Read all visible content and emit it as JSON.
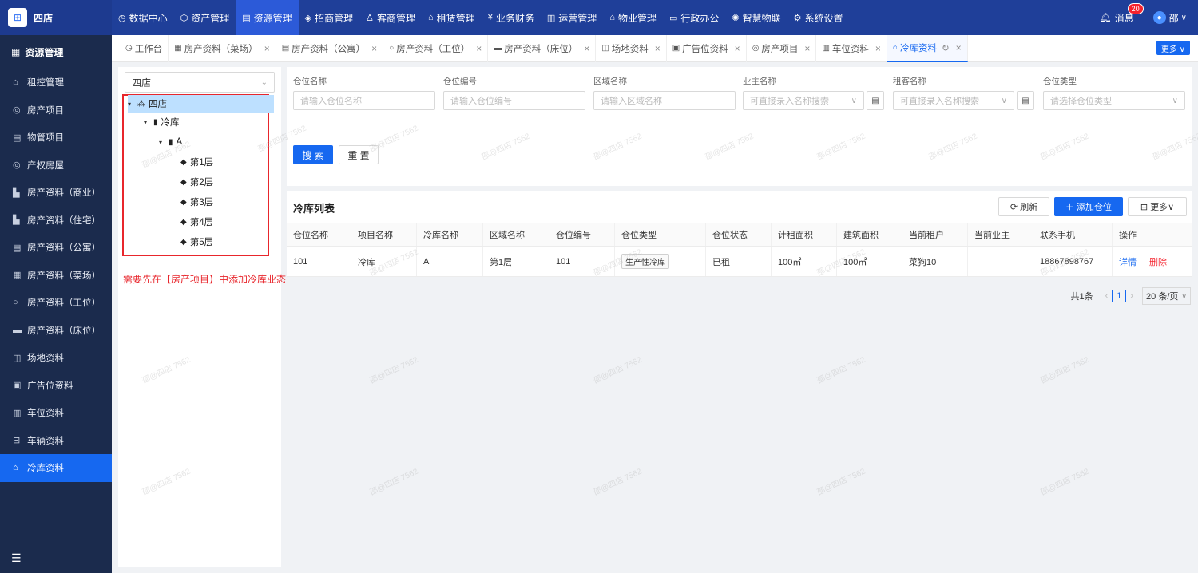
{
  "brand": {
    "logo": "⊞",
    "name": "四店"
  },
  "topnav": [
    {
      "icon": "◷",
      "label": "数据中心"
    },
    {
      "icon": "⬡",
      "label": "资产管理"
    },
    {
      "icon": "▤",
      "label": "资源管理",
      "active": true
    },
    {
      "icon": "◈",
      "label": "招商管理"
    },
    {
      "icon": "♙",
      "label": "客商管理"
    },
    {
      "icon": "⌂",
      "label": "租赁管理"
    },
    {
      "icon": "¥",
      "label": "业务财务"
    },
    {
      "icon": "▥",
      "label": "运营管理"
    },
    {
      "icon": "⌂",
      "label": "物业管理"
    },
    {
      "icon": "▭",
      "label": "行政办公"
    },
    {
      "icon": "✺",
      "label": "智慧物联"
    },
    {
      "icon": "⚙",
      "label": "系统设置"
    }
  ],
  "header_right": {
    "msg_label": "消息",
    "msg_count": "20",
    "user": "邵",
    "user_chev": "∨"
  },
  "sidebar": {
    "title": "资源管理",
    "items": [
      {
        "icon": "⌂",
        "label": "租控管理"
      },
      {
        "icon": "◎",
        "label": "房产项目"
      },
      {
        "icon": "▤",
        "label": "物管项目"
      },
      {
        "icon": "◎",
        "label": "产权房屋"
      },
      {
        "icon": "▙",
        "label": "房产资料（商业）"
      },
      {
        "icon": "▙",
        "label": "房产资料（住宅）"
      },
      {
        "icon": "▤",
        "label": "房产资料（公寓）"
      },
      {
        "icon": "▦",
        "label": "房产资料（菜场）"
      },
      {
        "icon": "○",
        "label": "房产资料（工位）"
      },
      {
        "icon": "▬",
        "label": "房产资料（床位）"
      },
      {
        "icon": "◫",
        "label": "场地资料"
      },
      {
        "icon": "▣",
        "label": "广告位资料"
      },
      {
        "icon": "▥",
        "label": "车位资料"
      },
      {
        "icon": "⊟",
        "label": "车辆资料"
      },
      {
        "icon": "⌂",
        "label": "冷库资料",
        "active": true
      }
    ],
    "bottom_icon": "☰"
  },
  "tabs": [
    {
      "icon": "◷",
      "label": "工作台"
    },
    {
      "icon": "▦",
      "label": "房产资料（菜场）",
      "close": "×"
    },
    {
      "icon": "▤",
      "label": "房产资料（公寓）",
      "close": "×"
    },
    {
      "icon": "○",
      "label": "房产资料（工位）",
      "close": "×"
    },
    {
      "icon": "▬",
      "label": "房产资料（床位）",
      "close": "×"
    },
    {
      "icon": "◫",
      "label": "场地资料",
      "close": "×"
    },
    {
      "icon": "▣",
      "label": "广告位资料",
      "close": "×"
    },
    {
      "icon": "◎",
      "label": "房产项目",
      "close": "×"
    },
    {
      "icon": "▥",
      "label": "车位资料",
      "close": "×"
    },
    {
      "icon": "⌂",
      "label": "冷库资料",
      "close": "×",
      "active": true,
      "refresh": "↻"
    }
  ],
  "tabs_more": "更多 ∨",
  "tree": {
    "select_value": "四店",
    "nodes": [
      {
        "arrow": "▾",
        "icon": "⁂",
        "label": "四店",
        "selected": true
      },
      {
        "arrow": "▾",
        "icon": "▮",
        "label": "冷库"
      },
      {
        "arrow": "▾",
        "icon": "▮",
        "label": "A"
      },
      {
        "arrow": "",
        "icon": "◆",
        "label": "第1层"
      },
      {
        "arrow": "",
        "icon": "◆",
        "label": "第2层"
      },
      {
        "arrow": "",
        "icon": "◆",
        "label": "第3层"
      },
      {
        "arrow": "",
        "icon": "◆",
        "label": "第4层"
      },
      {
        "arrow": "",
        "icon": "◆",
        "label": "第5层"
      }
    ],
    "note": "需要先在【房产项目】中添加冷库业态的信息"
  },
  "filters": [
    {
      "label": "仓位名称",
      "placeholder": "请输入仓位名称"
    },
    {
      "label": "仓位编号",
      "placeholder": "请输入仓位编号"
    },
    {
      "label": "区域名称",
      "placeholder": "请输入区域名称"
    },
    {
      "label": "业主名称",
      "placeholder": "可直接录入名称搜索",
      "chev": "∨",
      "clip": "▤"
    },
    {
      "label": "租客名称",
      "placeholder": "可直接录入名称搜索",
      "chev": "∨",
      "clip": "▤"
    },
    {
      "label": "仓位类型",
      "placeholder": "请选择仓位类型",
      "chev": "∨"
    }
  ],
  "buttons": {
    "search": "搜 索",
    "reset": "重 置"
  },
  "list": {
    "title": "冷库列表",
    "refresh": "⟳ 刷新",
    "add": "＋ 添加仓位",
    "more": "⊞ 更多∨",
    "columns": [
      "仓位名称",
      "项目名称",
      "冷库名称",
      "区域名称",
      "仓位编号",
      "仓位类型",
      "仓位状态",
      "计租面积",
      "建筑面积",
      "当前租户",
      "当前业主",
      "联系手机",
      "操作"
    ],
    "rows": [
      {
        "c0": "101",
        "c1": "冷库",
        "c2": "A",
        "c3": "第1层",
        "c4": "101",
        "c5": "生产性冷库",
        "c6": "已租",
        "c7": "100㎡",
        "c8": "100㎡",
        "c9": "菜狗10",
        "c10": "",
        "c11": "18867898767",
        "detail": "详情",
        "delete": "删除"
      }
    ]
  },
  "pager": {
    "total": "共1条",
    "prev": "‹",
    "page": "1",
    "next": "›",
    "size": "20 条/页",
    "size_chev": "∨"
  },
  "watermark": "邵@四店 7562"
}
